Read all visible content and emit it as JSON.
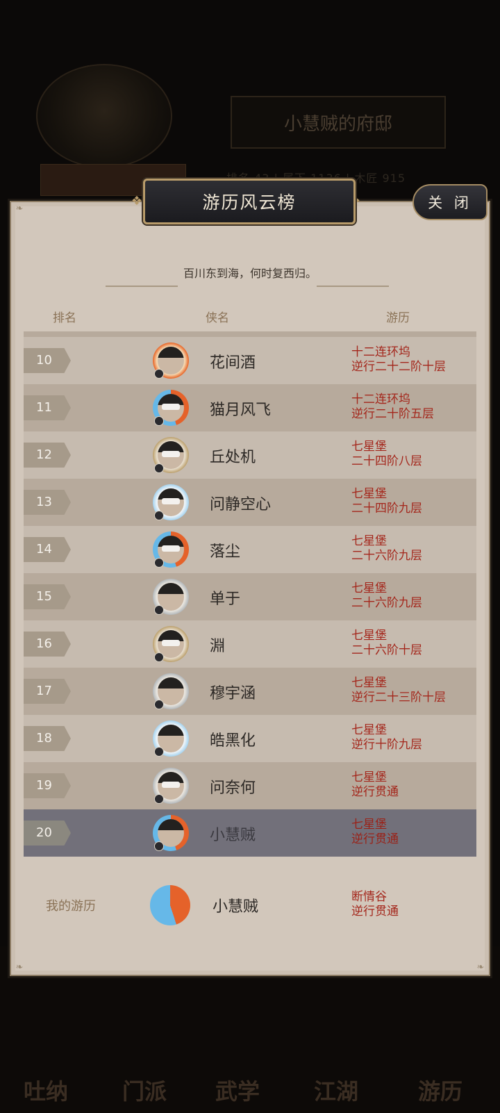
{
  "background": {
    "residence_title": "小慧贼的府邸",
    "stats_text": "排名  43  |  属下  1136  |  木匠  915",
    "nav": [
      "吐纳",
      "门派",
      "武学",
      "江湖",
      "游历"
    ]
  },
  "modal": {
    "title": "游历风云榜",
    "close_label": "关 闭",
    "subtitle": "百川东到海，何时复西归。",
    "columns": {
      "rank": "排名",
      "name": "侠名",
      "progress": "游历"
    }
  },
  "rows": [
    {
      "rank": "10",
      "name": "花间酒",
      "line1": "十二连环坞",
      "line2": "逆行二十二阶十层",
      "frame": "fire",
      "avatar": "female-long-hair"
    },
    {
      "rank": "11",
      "name": "猫月风飞",
      "line1": "十二连环坞",
      "line2": "逆行二十阶五层",
      "frame": "fire-ice",
      "avatar": "masked"
    },
    {
      "rank": "12",
      "name": "丘处机",
      "line1": "七星堡",
      "line2": "二十四阶八层",
      "frame": "gold",
      "avatar": "masked"
    },
    {
      "rank": "13",
      "name": "问静空心",
      "line1": "七星堡",
      "line2": "二十四阶九层",
      "frame": "ice",
      "avatar": "masked"
    },
    {
      "rank": "14",
      "name": "落尘",
      "line1": "七星堡",
      "line2": "二十六阶九层",
      "frame": "fire-ice",
      "avatar": "masked"
    },
    {
      "rank": "15",
      "name": "单于",
      "line1": "七星堡",
      "line2": "二十六阶九层",
      "frame": "cloud",
      "avatar": "bearded"
    },
    {
      "rank": "16",
      "name": "淵",
      "line1": "七星堡",
      "line2": "二十六阶十层",
      "frame": "gold",
      "avatar": "masked"
    },
    {
      "rank": "17",
      "name": "穆宇涵",
      "line1": "七星堡",
      "line2": "逆行二十三阶十层",
      "frame": "cloud",
      "avatar": "female"
    },
    {
      "rank": "18",
      "name": "皓黑化",
      "line1": "七星堡",
      "line2": "逆行十阶九层",
      "frame": "ice",
      "avatar": "wild-hair"
    },
    {
      "rank": "19",
      "name": "问奈何",
      "line1": "七星堡",
      "line2": "逆行贯通",
      "frame": "cloud",
      "avatar": "masked"
    },
    {
      "rank": "20",
      "name": "小慧贼",
      "line1": "七星堡",
      "line2": "逆行贯通",
      "frame": "fire-ice",
      "avatar": "female",
      "is_me": true
    }
  ],
  "my_record": {
    "label": "我的游历",
    "name": "小慧贼",
    "line1": "断情谷",
    "line2": "逆行贯通"
  },
  "colors": {
    "panel_bg": "#d2c7bb",
    "row_odd": "#c6bbaf",
    "row_even": "#b7aa9c",
    "row_me": "#72707a",
    "progress_red": "#a4271c",
    "header_gold": "#8a7256"
  }
}
